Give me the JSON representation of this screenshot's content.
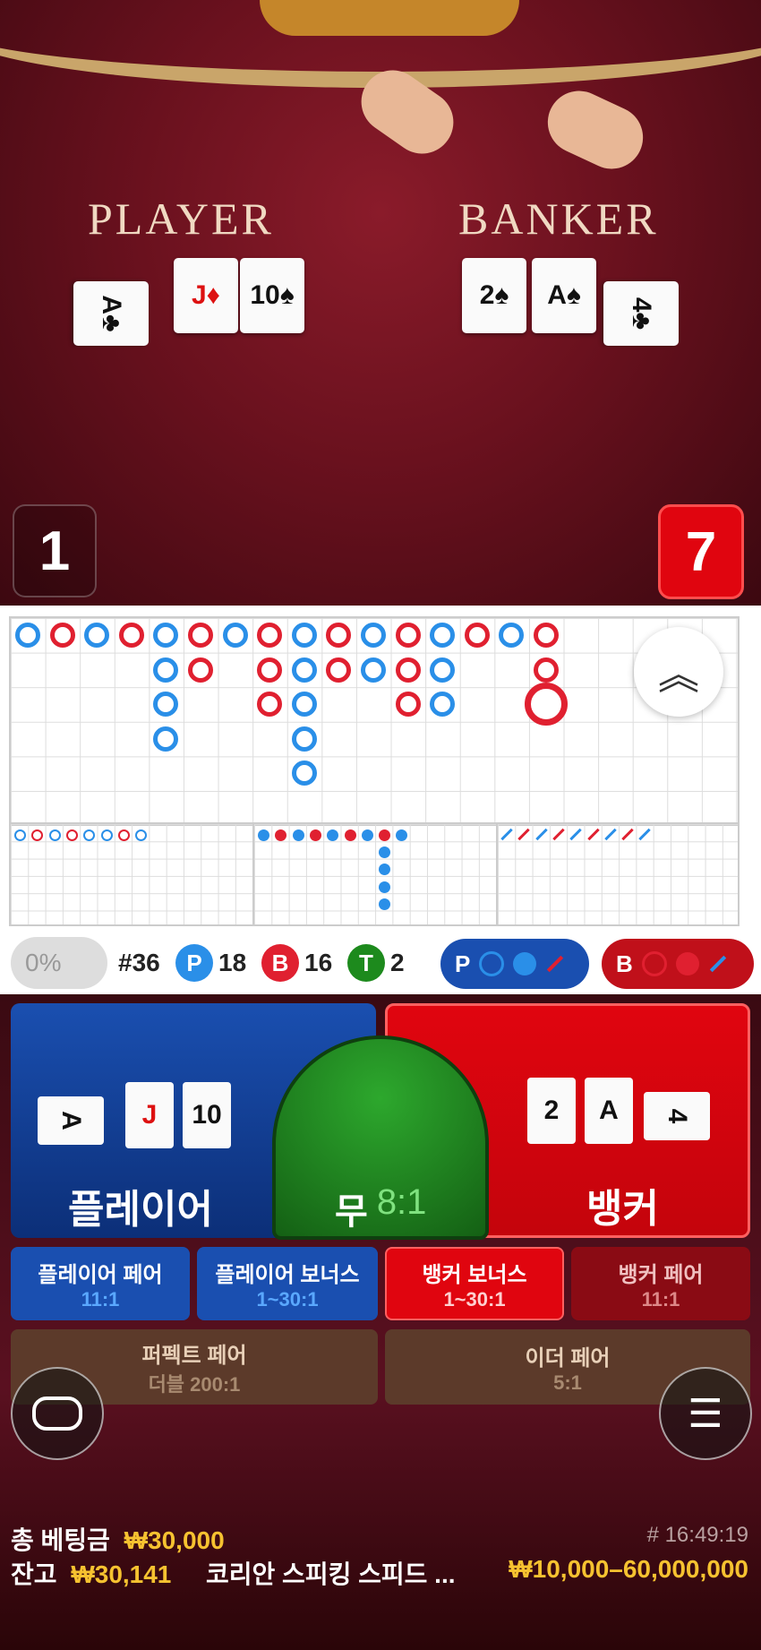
{
  "video": {
    "player_label": "PLAYER",
    "banker_label": "BANKER",
    "player_cards": [
      "A♣",
      "J♦",
      "10♠"
    ],
    "banker_cards": [
      "2♠",
      "A♠",
      "4♣"
    ],
    "player_score": "1",
    "banker_score": "7"
  },
  "stats": {
    "percent": "0%",
    "round": "#36",
    "p_letter": "P",
    "p_count": "18",
    "b_letter": "B",
    "b_count": "16",
    "t_letter": "T",
    "t_count": "2",
    "p_predict": "P",
    "b_predict": "B"
  },
  "bets": {
    "player_label": "플레이어",
    "tie_label": "무",
    "tie_odds": "8:1",
    "banker_label": "뱅커",
    "player_cards": [
      "A",
      "J",
      "10"
    ],
    "banker_cards": [
      "2",
      "A",
      "4"
    ],
    "side": [
      {
        "label": "플레이어 페어",
        "odds": "11:1"
      },
      {
        "label": "플레이어 보너스",
        "odds": "1~30:1"
      },
      {
        "label": "뱅커 보너스",
        "odds": "1~30:1"
      },
      {
        "label": "뱅커 페어",
        "odds": "11:1"
      }
    ],
    "perfect_label": "퍼펙트 페어",
    "perfect_odds": "더블 200:1",
    "either_label": "이더 페어",
    "either_odds": "5:1"
  },
  "footer": {
    "total_bet_label": "총 베팅금",
    "total_bet": "₩30,000",
    "time": "# 16:49:19",
    "balance_label": "잔고",
    "balance": "₩30,141",
    "table_name": "코리안 스피킹 스피드 ...",
    "limits": "₩10,000–60,000,000"
  },
  "colors": {
    "player": "#1a4fb0",
    "banker": "#e0050f",
    "tie": "#1d8a1d",
    "gold": "#f6c230"
  }
}
